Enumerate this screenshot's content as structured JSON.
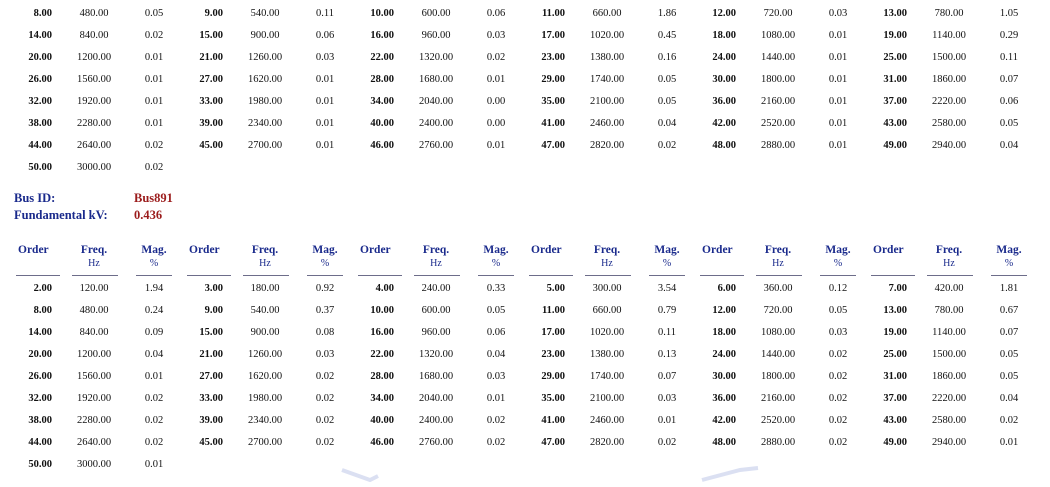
{
  "table1": {
    "rows": [
      [
        [
          "8.00",
          "480.00",
          "0.05"
        ],
        [
          "9.00",
          "540.00",
          "0.11"
        ],
        [
          "10.00",
          "600.00",
          "0.06"
        ],
        [
          "11.00",
          "660.00",
          "1.86"
        ],
        [
          "12.00",
          "720.00",
          "0.03"
        ],
        [
          "13.00",
          "780.00",
          "1.05"
        ]
      ],
      [
        [
          "14.00",
          "840.00",
          "0.02"
        ],
        [
          "15.00",
          "900.00",
          "0.06"
        ],
        [
          "16.00",
          "960.00",
          "0.03"
        ],
        [
          "17.00",
          "1020.00",
          "0.45"
        ],
        [
          "18.00",
          "1080.00",
          "0.01"
        ],
        [
          "19.00",
          "1140.00",
          "0.29"
        ]
      ],
      [
        [
          "20.00",
          "1200.00",
          "0.01"
        ],
        [
          "21.00",
          "1260.00",
          "0.03"
        ],
        [
          "22.00",
          "1320.00",
          "0.02"
        ],
        [
          "23.00",
          "1380.00",
          "0.16"
        ],
        [
          "24.00",
          "1440.00",
          "0.01"
        ],
        [
          "25.00",
          "1500.00",
          "0.11"
        ]
      ],
      [
        [
          "26.00",
          "1560.00",
          "0.01"
        ],
        [
          "27.00",
          "1620.00",
          "0.01"
        ],
        [
          "28.00",
          "1680.00",
          "0.01"
        ],
        [
          "29.00",
          "1740.00",
          "0.05"
        ],
        [
          "30.00",
          "1800.00",
          "0.01"
        ],
        [
          "31.00",
          "1860.00",
          "0.07"
        ]
      ],
      [
        [
          "32.00",
          "1920.00",
          "0.01"
        ],
        [
          "33.00",
          "1980.00",
          "0.01"
        ],
        [
          "34.00",
          "2040.00",
          "0.00"
        ],
        [
          "35.00",
          "2100.00",
          "0.05"
        ],
        [
          "36.00",
          "2160.00",
          "0.01"
        ],
        [
          "37.00",
          "2220.00",
          "0.06"
        ]
      ],
      [
        [
          "38.00",
          "2280.00",
          "0.01"
        ],
        [
          "39.00",
          "2340.00",
          "0.01"
        ],
        [
          "40.00",
          "2400.00",
          "0.00"
        ],
        [
          "41.00",
          "2460.00",
          "0.04"
        ],
        [
          "42.00",
          "2520.00",
          "0.01"
        ],
        [
          "43.00",
          "2580.00",
          "0.05"
        ]
      ],
      [
        [
          "44.00",
          "2640.00",
          "0.02"
        ],
        [
          "45.00",
          "2700.00",
          "0.01"
        ],
        [
          "46.00",
          "2760.00",
          "0.01"
        ],
        [
          "47.00",
          "2820.00",
          "0.02"
        ],
        [
          "48.00",
          "2880.00",
          "0.01"
        ],
        [
          "49.00",
          "2940.00",
          "0.04"
        ]
      ],
      [
        [
          "50.00",
          "3000.00",
          "0.02"
        ]
      ]
    ]
  },
  "bus": {
    "id_label": "Bus ID:",
    "id_value": "Bus891",
    "kv_label": "Fundamental kV:",
    "kv_value": "0.436"
  },
  "table2": {
    "headers": {
      "order": "Order",
      "freq": "Freq.",
      "freq_unit": "Hz",
      "mag": "Mag.",
      "mag_unit": "%"
    },
    "rows": [
      [
        [
          "2.00",
          "120.00",
          "1.94"
        ],
        [
          "3.00",
          "180.00",
          "0.92"
        ],
        [
          "4.00",
          "240.00",
          "0.33"
        ],
        [
          "5.00",
          "300.00",
          "3.54"
        ],
        [
          "6.00",
          "360.00",
          "0.12"
        ],
        [
          "7.00",
          "420.00",
          "1.81"
        ]
      ],
      [
        [
          "8.00",
          "480.00",
          "0.24"
        ],
        [
          "9.00",
          "540.00",
          "0.37"
        ],
        [
          "10.00",
          "600.00",
          "0.05"
        ],
        [
          "11.00",
          "660.00",
          "0.79"
        ],
        [
          "12.00",
          "720.00",
          "0.05"
        ],
        [
          "13.00",
          "780.00",
          "0.67"
        ]
      ],
      [
        [
          "14.00",
          "840.00",
          "0.09"
        ],
        [
          "15.00",
          "900.00",
          "0.08"
        ],
        [
          "16.00",
          "960.00",
          "0.06"
        ],
        [
          "17.00",
          "1020.00",
          "0.11"
        ],
        [
          "18.00",
          "1080.00",
          "0.03"
        ],
        [
          "19.00",
          "1140.00",
          "0.07"
        ]
      ],
      [
        [
          "20.00",
          "1200.00",
          "0.04"
        ],
        [
          "21.00",
          "1260.00",
          "0.03"
        ],
        [
          "22.00",
          "1320.00",
          "0.04"
        ],
        [
          "23.00",
          "1380.00",
          "0.13"
        ],
        [
          "24.00",
          "1440.00",
          "0.02"
        ],
        [
          "25.00",
          "1500.00",
          "0.05"
        ]
      ],
      [
        [
          "26.00",
          "1560.00",
          "0.01"
        ],
        [
          "27.00",
          "1620.00",
          "0.02"
        ],
        [
          "28.00",
          "1680.00",
          "0.03"
        ],
        [
          "29.00",
          "1740.00",
          "0.07"
        ],
        [
          "30.00",
          "1800.00",
          "0.02"
        ],
        [
          "31.00",
          "1860.00",
          "0.05"
        ]
      ],
      [
        [
          "32.00",
          "1920.00",
          "0.02"
        ],
        [
          "33.00",
          "1980.00",
          "0.02"
        ],
        [
          "34.00",
          "2040.00",
          "0.01"
        ],
        [
          "35.00",
          "2100.00",
          "0.03"
        ],
        [
          "36.00",
          "2160.00",
          "0.02"
        ],
        [
          "37.00",
          "2220.00",
          "0.04"
        ]
      ],
      [
        [
          "38.00",
          "2280.00",
          "0.02"
        ],
        [
          "39.00",
          "2340.00",
          "0.02"
        ],
        [
          "40.00",
          "2400.00",
          "0.02"
        ],
        [
          "41.00",
          "2460.00",
          "0.01"
        ],
        [
          "42.00",
          "2520.00",
          "0.02"
        ],
        [
          "43.00",
          "2580.00",
          "0.02"
        ]
      ],
      [
        [
          "44.00",
          "2640.00",
          "0.02"
        ],
        [
          "45.00",
          "2700.00",
          "0.02"
        ],
        [
          "46.00",
          "2760.00",
          "0.02"
        ],
        [
          "47.00",
          "2820.00",
          "0.02"
        ],
        [
          "48.00",
          "2880.00",
          "0.02"
        ],
        [
          "49.00",
          "2940.00",
          "0.01"
        ]
      ],
      [
        [
          "50.00",
          "3000.00",
          "0.01"
        ]
      ]
    ]
  }
}
